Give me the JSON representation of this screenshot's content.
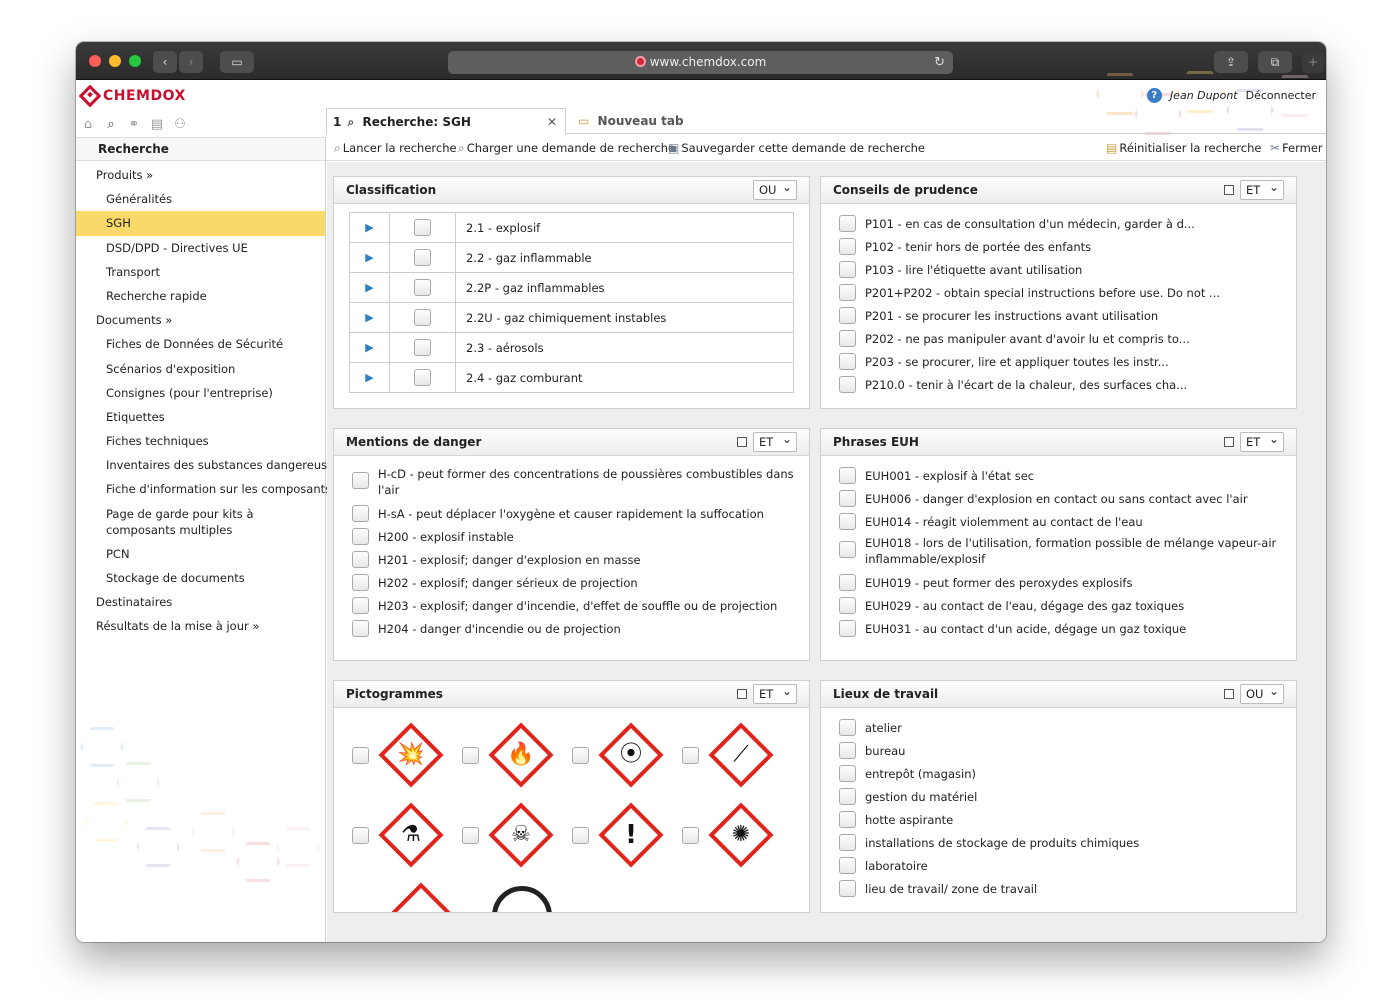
{
  "browser": {
    "url": "www.chemdox.com"
  },
  "app": {
    "logo_text": "CHEMDOX",
    "user": "Jean Dupont",
    "logout_label": "Déconnecter",
    "help_label": "?"
  },
  "tabs": {
    "active_number": "1",
    "active_label": "Recherche: SGH",
    "close_label": "✕",
    "new_tab_label": "Nouveau tab"
  },
  "toolbar": {
    "launch_label": "Lancer la recherche",
    "load_label": "Charger une demande de recherche",
    "save_label": "Sauvegarder cette demande de recherche",
    "reset_label": "Réinitialiser la recherche",
    "close_label": "Fermer"
  },
  "sidebar": {
    "header": "Recherche",
    "items": [
      {
        "label": "Produits »",
        "type": "group"
      },
      {
        "label": "Généralités",
        "type": "item"
      },
      {
        "label": "SGH",
        "type": "item",
        "selected": true
      },
      {
        "label": "DSD/DPD - Directives UE",
        "type": "item"
      },
      {
        "label": "Transport",
        "type": "item"
      },
      {
        "label": "Recherche rapide",
        "type": "item"
      },
      {
        "label": "Documents »",
        "type": "group"
      },
      {
        "label": "Fiches de Données de Sécurité",
        "type": "item"
      },
      {
        "label": "Scénarios d'exposition",
        "type": "item"
      },
      {
        "label": "Consignes (pour l'entreprise)",
        "type": "item"
      },
      {
        "label": "Etiquettes",
        "type": "item"
      },
      {
        "label": "Fiches techniques",
        "type": "item"
      },
      {
        "label": "Inventaires des substances dangereuses",
        "type": "item"
      },
      {
        "label": "Fiche d'information sur les composants",
        "type": "item"
      },
      {
        "label": "Page de garde pour kits à composants multiples",
        "type": "item",
        "multi": true
      },
      {
        "label": "PCN",
        "type": "item"
      },
      {
        "label": "Stockage de documents",
        "type": "item"
      },
      {
        "label": "Destinataires",
        "type": "group"
      },
      {
        "label": "Résultats de la mise à jour »",
        "type": "group"
      }
    ]
  },
  "panels": {
    "classification": {
      "title": "Classification",
      "operator": "OU",
      "rows": [
        "2.1 - explosif",
        "2.2 - gaz inflammable",
        "2.2P - gaz inflammables",
        "2.2U - gaz chimiquement instables",
        "2.3 - aérosols",
        "2.4 - gaz comburant"
      ]
    },
    "precaution": {
      "title": "Conseils de prudence",
      "operator": "ET",
      "rows": [
        "P101 - en cas de consultation d'un médecin, garder à d...",
        "P102 - tenir hors de portée des enfants",
        "P103 - lire l'étiquette avant utilisation",
        "P201+P202 - obtain special instructions before use. Do not ...",
        "P201 - se procurer les instructions avant utilisation",
        "P202 - ne pas manipuler avant d'avoir lu et compris to...",
        "P203 - se procurer, lire et appliquer toutes les instr...",
        "P210.0 - tenir à l'écart de la chaleur, des surfaces cha..."
      ]
    },
    "hazard": {
      "title": "Mentions de danger",
      "operator": "ET",
      "rows": [
        "H-cD - peut former des concentrations de poussières combustibles dans l'air",
        "H-sA - peut déplacer l'oxygène et causer rapidement la suffocation",
        "H200 - explosif instable",
        "H201 - explosif; danger d'explosion en masse",
        "H202 - explosif; danger sérieux de projection",
        "H203 - explosif; danger d'incendie, d'effet de souffle ou de projection",
        "H204 - danger d'incendie ou de projection"
      ]
    },
    "euh": {
      "title": "Phrases EUH",
      "operator": "ET",
      "rows": [
        "EUH001 - explosif à l'état sec",
        "EUH006 - danger d'explosion en contact ou sans contact avec l'air",
        "EUH014 - réagit violemment au contact de l'eau",
        "EUH018 - lors de l'utilisation, formation possible de mélange vapeur-air inflammable/explosif",
        "EUH019 - peut former des peroxydes explosifs",
        "EUH029 - au contact de l'eau, dégage des gaz toxiques",
        "EUH031 - au contact d'un acide, dégage un gaz toxique"
      ]
    },
    "pictograms": {
      "title": "Pictogrammes",
      "operator": "ET",
      "symbols": [
        "💥",
        "🔥",
        "⦿",
        "⟋",
        "⚗",
        "☠",
        "!",
        "✺"
      ]
    },
    "workplaces": {
      "title": "Lieux de travail",
      "operator": "OU",
      "rows": [
        "atelier",
        "bureau",
        "entrepôt (magasin)",
        "gestion du matériel",
        "hotte aspirante",
        "installations de stockage de produits chimiques",
        "laboratoire",
        "lieu de travail/ zone de travail"
      ]
    }
  }
}
